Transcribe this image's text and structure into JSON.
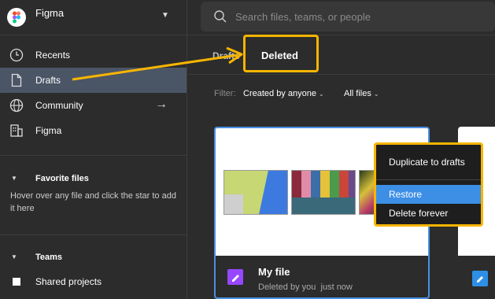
{
  "account": {
    "name": "Figma"
  },
  "nav": [
    {
      "label": "Recents",
      "icon": "clock-icon"
    },
    {
      "label": "Drafts",
      "icon": "file-icon"
    },
    {
      "label": "Community",
      "icon": "globe-icon"
    },
    {
      "label": "Figma",
      "icon": "building-icon"
    }
  ],
  "favorites": {
    "title": "Favorite files",
    "hint": "Hover over any file and click the star to add it here"
  },
  "teams": {
    "title": "Teams",
    "items": [
      {
        "label": "Shared projects"
      }
    ]
  },
  "search": {
    "placeholder": "Search files, teams, or people"
  },
  "tabs": {
    "drafts": "Drafts",
    "deleted": "Deleted"
  },
  "filters": {
    "label": "Filter:",
    "owner": "Created by anyone",
    "type": "All files"
  },
  "file": {
    "name": "My file",
    "deleted_by": "Deleted by you",
    "when": "just now"
  },
  "context_menu": {
    "items": [
      "Duplicate to drafts",
      "Restore",
      "Delete forever"
    ]
  },
  "colors": {
    "highlight": "#f7b500",
    "selected": "#3d8fe5",
    "accent_border": "#4a90e2"
  }
}
